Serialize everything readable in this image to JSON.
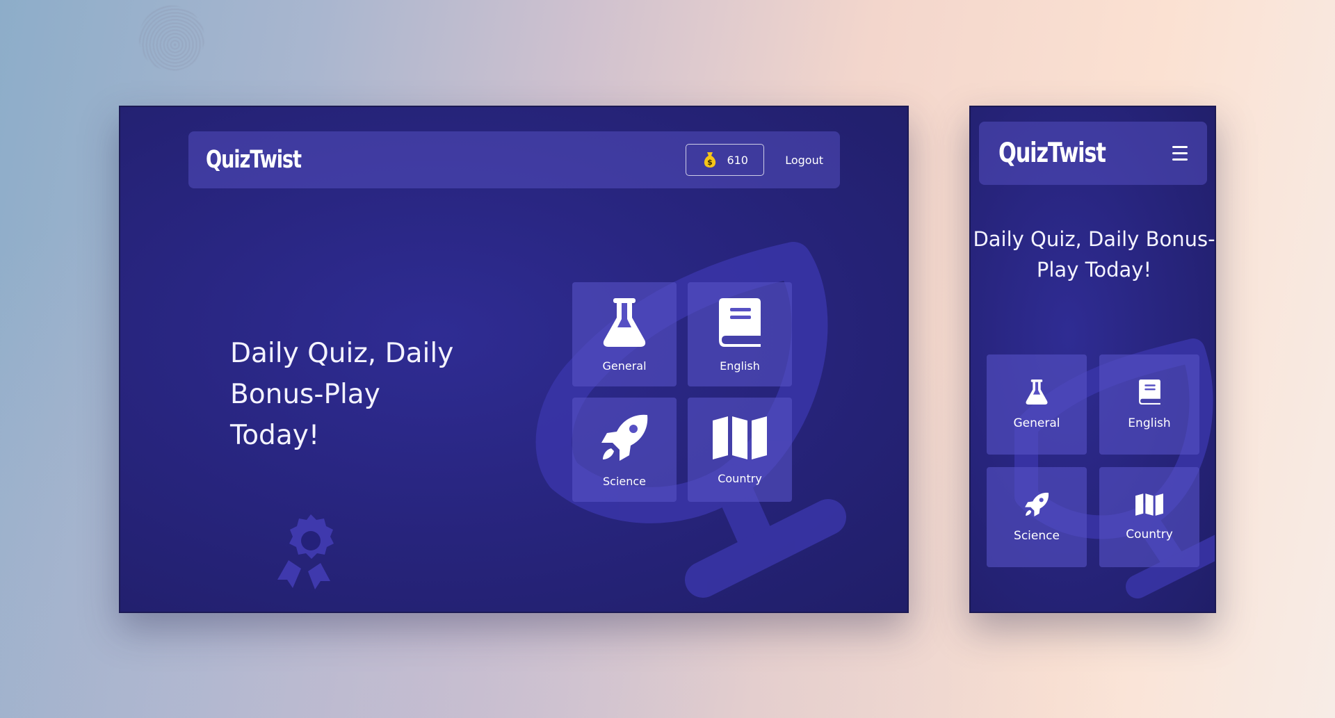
{
  "desktop": {
    "brand": "QuizTwist",
    "coins": "610",
    "logout": "Logout",
    "hero": "Daily Quiz, Daily Bonus-Play Today!",
    "categories": [
      {
        "label": "General",
        "icon": "flask-icon"
      },
      {
        "label": "English",
        "icon": "book-icon"
      },
      {
        "label": "Science",
        "icon": "rocket-icon"
      },
      {
        "label": "Country",
        "icon": "map-icon"
      }
    ]
  },
  "mobile": {
    "brand": "QuizTwist",
    "hero": "Daily Quiz, Daily Bonus-Play Today!",
    "categories": [
      {
        "label": "General",
        "icon": "flask-icon"
      },
      {
        "label": "English",
        "icon": "book-icon"
      },
      {
        "label": "Science",
        "icon": "rocket-icon"
      },
      {
        "label": "Country",
        "icon": "map-icon"
      }
    ]
  },
  "colors": {
    "frame_bg": "#28257f",
    "tile_bg": "#5650c3",
    "coin_bag": "#f5c518",
    "decor": "#3a35a8"
  }
}
